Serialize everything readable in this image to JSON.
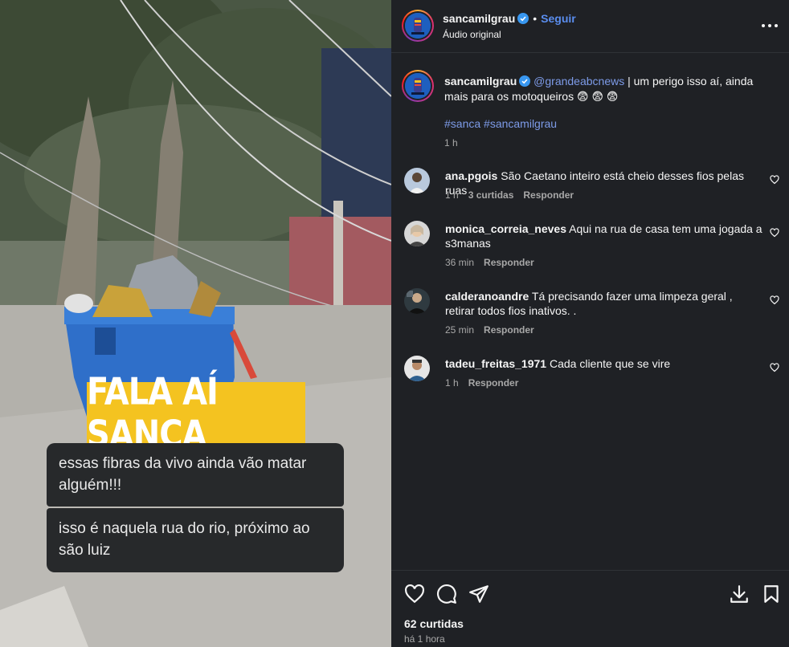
{
  "media": {
    "banner_text": "FALA AÍ SANCA",
    "messages": [
      "essas fibras da vivo ainda vão matar alguém!!!",
      "isso é naquela rua do rio, próximo ao são luiz"
    ]
  },
  "header": {
    "username": "sancamilgrau",
    "follow_label": "Seguir",
    "subtitle": "Áudio original",
    "more_icon": "more-horizontal-icon"
  },
  "caption": {
    "username": "sancamilgrau",
    "mention": "@grandeabcnews",
    "text": " | um perigo isso aí, ainda mais para os motoqueiros 😨 😨 😨",
    "hashtags": "#sanca #sancamilgrau",
    "time": "1 h"
  },
  "comments": [
    {
      "username": "ana.pgois",
      "text": "São Caetano inteiro está cheio desses fios pelas ruas",
      "time": "1 h",
      "likes": "3 curtidas",
      "reply": "Responder"
    },
    {
      "username": "monica_correia_neves",
      "text": "Aqui na rua de casa tem uma jogada a s3manas",
      "time": "36 min",
      "likes": "",
      "reply": "Responder"
    },
    {
      "username": "calderanoandre",
      "text": "Tá precisando fazer uma limpeza geral , retirar todos fios inativos. .",
      "time": "25 min",
      "likes": "",
      "reply": "Responder"
    },
    {
      "username": "tadeu_freitas_1971",
      "text": "Cada cliente que se vire",
      "time": "1 h",
      "likes": "",
      "reply": "Responder"
    }
  ],
  "actions": {
    "likes_count": "62 curtidas",
    "posted": "há 1 hora",
    "icons": [
      "heart-icon",
      "comment-icon",
      "share-icon",
      "download-icon",
      "bookmark-icon"
    ]
  },
  "colors": {
    "panel_bg": "#1f2125",
    "link": "#7d9be8",
    "follow": "#5a8dee",
    "banner": "#f4c320",
    "verified": "#3897f0"
  }
}
